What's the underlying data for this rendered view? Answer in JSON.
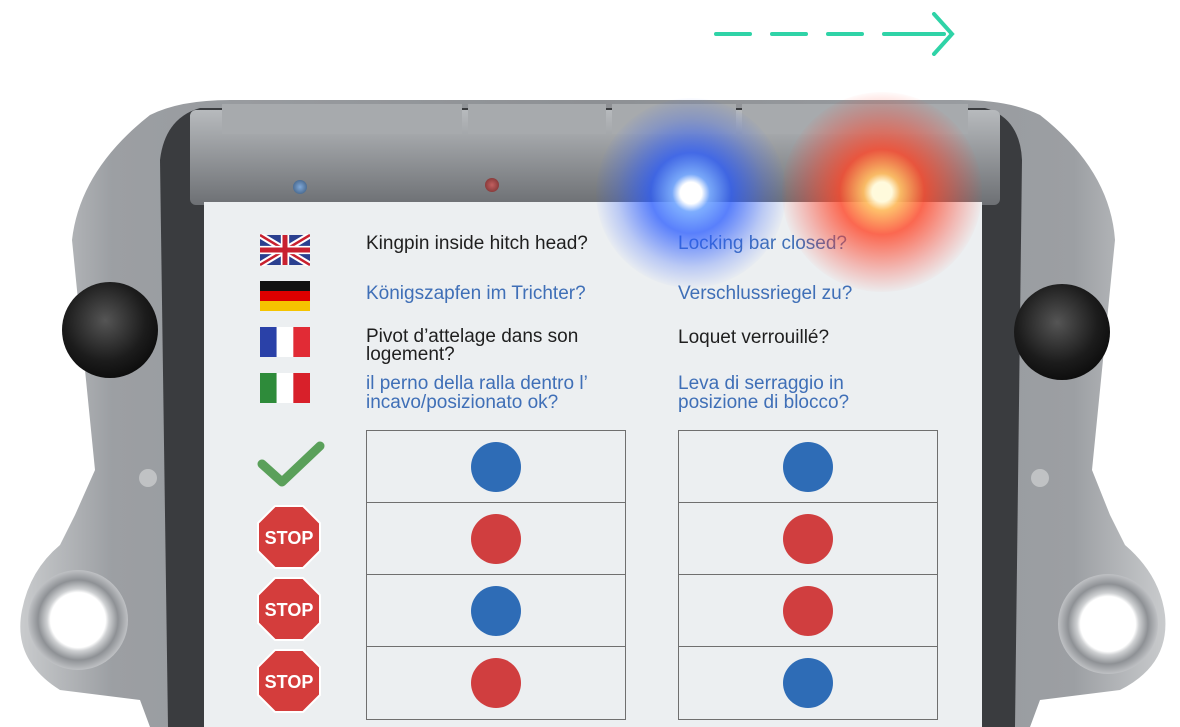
{
  "panel": {
    "rows": [
      {
        "flag": "uk-flag-icon",
        "left": "Kingpin inside hitch head?",
        "right": "Locking bar closed?",
        "color": "dark"
      },
      {
        "flag": "germany-flag-icon",
        "left": "Königszapfen im Trichter?",
        "right": "Verschlussriegel zu?",
        "color": "blue"
      },
      {
        "flag": "france-flag-icon",
        "left": "Pivot d’attelage dans son logement?",
        "right": "Loquet verrouillé?",
        "color": "dark"
      },
      {
        "flag": "italy-flag-icon",
        "left": "il perno della ralla dentro l’ incavo/posizionato ok?",
        "right": "Leva di serraggio in posizione di blocco?",
        "color": "blue"
      }
    ],
    "status_rows": [
      {
        "icon": "checkmark-icon",
        "label": "",
        "left": "blue",
        "right": "blue"
      },
      {
        "icon": "stop-sign-icon",
        "label": "STOP",
        "left": "red",
        "right": "red"
      },
      {
        "icon": "stop-sign-icon",
        "label": "STOP",
        "left": "blue",
        "right": "red"
      },
      {
        "icon": "stop-sign-icon",
        "label": "STOP",
        "left": "red",
        "right": "blue"
      }
    ]
  },
  "colors": {
    "indicator_blue": "#2e6cb6",
    "indicator_red": "#d03e3f",
    "accent_arrow": "#2fd3a7",
    "check_green": "#5aa05a"
  }
}
